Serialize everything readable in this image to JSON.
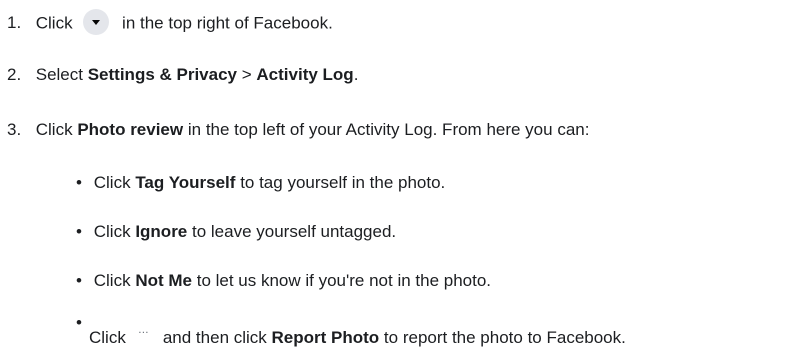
{
  "steps": [
    {
      "num": "1.",
      "pre": "Click",
      "post": "in the top right of Facebook."
    },
    {
      "num": "2.",
      "pre": "Select",
      "bold1": "Settings & Privacy",
      "mid": ">",
      "bold2": "Activity Log",
      "post": "."
    },
    {
      "num": "3.",
      "pre": "Click",
      "bold": "Photo review",
      "post": "in the top left of your Activity Log. From here you can:"
    }
  ],
  "bullets": [
    {
      "pre": "Click",
      "bold": "Tag Yourself",
      "post": "to tag yourself in the photo."
    },
    {
      "pre": "Click",
      "bold": "Ignore",
      "post": "to leave yourself untagged."
    },
    {
      "pre": "Click",
      "bold": "Not Me",
      "post": "to let us know if you're not in the photo."
    },
    {
      "pre": "Click",
      "icon": "…",
      "mid": "and then click",
      "bold": "Report Photo",
      "post": "to report the photo to Facebook."
    }
  ],
  "icons": {
    "dropdown": "chevron-down-icon",
    "more": "more-icon"
  }
}
